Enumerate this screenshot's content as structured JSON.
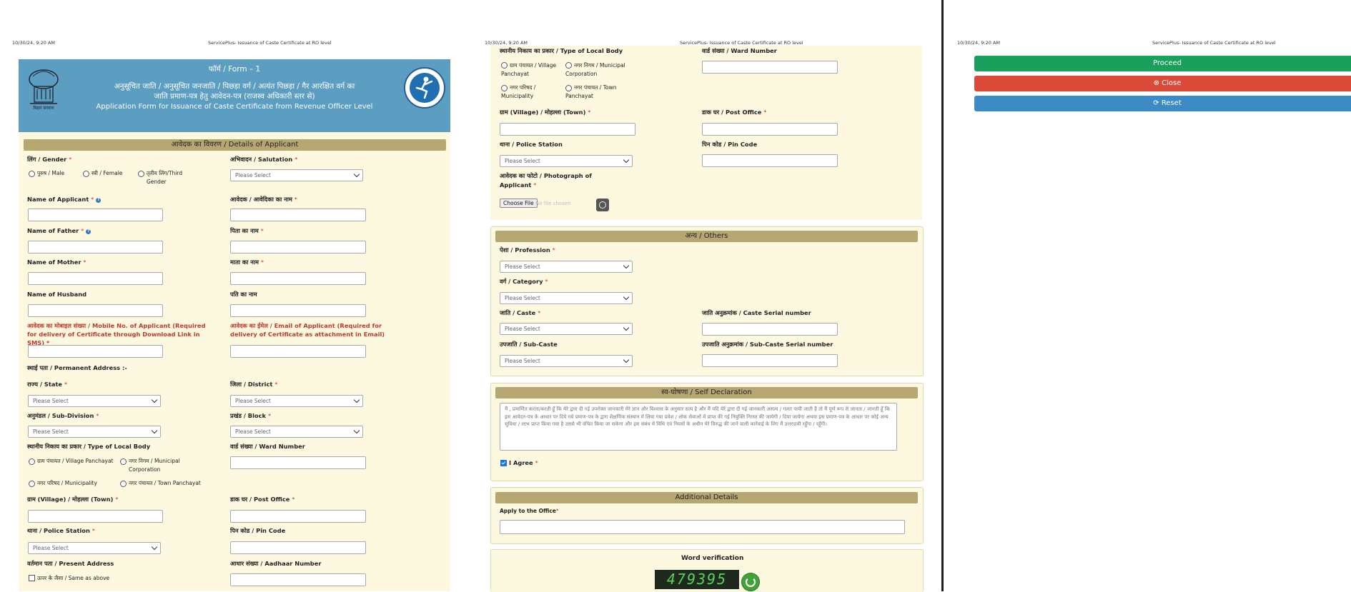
{
  "pages": [
    {
      "date": "10/30/24, 9:20 AM",
      "title": "ServicePlus- Issuance of Caste Certificate at RO level"
    },
    {
      "date": "10/30/24, 9:20 AM",
      "title": "ServicePlus- Issuance of Caste Certificate at RO level"
    },
    {
      "date": "10/30/24, 9:20 AM",
      "title": "ServicePlus- Issuance of Caste Certificate at RO level"
    }
  ],
  "banner": {
    "form_no": "फॉर्म / Form – 1",
    "hindi_line1": "अनुसूचित जाति / अनुसूचित जनजाति / पिछड़ा वर्ग / अत्यंत पिछड़ा / गैर आरक्षित वर्ग का",
    "hindi_line2": "जाति प्रमाण-पत्र हेतु आवेदन-पत्र (राजस्व अधिकारी स्तर से)",
    "english_title": "Application Form for Issuance of Caste Certificate from Revenue Officer Level",
    "emblem_caption": "बिहार सरकार"
  },
  "applicant": {
    "section_title": "आवेदक का विवरण / Details of Applicant",
    "gender_label": "लिंग / Gender",
    "gender_options": [
      "पुरुष / Male",
      "स्त्री / Female",
      "तृतीय लिंग/Third Gender"
    ],
    "salutation_label": "अभिवादन / Salutation",
    "name_label": "Name of Applicant",
    "name_hindi_label": "आवेदक / आवेदिका का नाम",
    "father_label": "Name of Father",
    "father_hindi_label": "पिता का नाम",
    "mother_label": "Name of Mother",
    "mother_hindi_label": "माता का नाम",
    "husband_label": "Name of Husband",
    "husband_hindi_label": "पति का नाम",
    "mobile_label": "आवेदक का मोबाइल संख्या / Mobile No. of Applicant (Required for delivery of Certificate through Download Link in SMS)",
    "email_label": "आवेदक का ईमेल / Email of Applicant (Required for delivery of Certificate as attachment in Email)",
    "permanent_address_label": "स्थाई पता / Permanent Address :-",
    "state_label": "राज्य / State",
    "district_label": "जिला / District",
    "subdivision_label": "अनुमंडल / Sub-Division",
    "block_label": "प्रखंड / Block",
    "local_body_label": "स्थानीय निकाय का प्रकार / Type of Local Body",
    "local_body_options": [
      "ग्राम पंचायत / Village Panchayat",
      "नगर निगम / Municipal Corporation",
      "नगर परिषद / Municipality",
      "नगर पंचायत / Town Panchayat"
    ],
    "ward_label": "वार्ड संख्या / Ward Number",
    "village_label": "ग्राम (Village) / मोहल्ला (Town)",
    "post_office_label": "डाक घर / Post Office",
    "police_label": "थाना / Police Station",
    "pin_label": "पिन कोड / Pin Code",
    "present_address_label": "वर्तमान पता / Present Address",
    "aadhaar_label": "आधार संख्या / Aadhaar Number",
    "same_as_above": "ऊपर के जैसा / Same as above"
  },
  "select_placeholder": "Please Select",
  "page2": {
    "local_body_label": "स्थानीय निकाय का प्रकार / Type of Local Body",
    "local_body_options": [
      "ग्राम पंचायत / Village Panchayat",
      "नगर निगम / Municipal Corporation",
      "नगर परिषद / Municipality",
      "नगर पंचायत / Town Panchayat"
    ],
    "ward_label": "वार्ड संख्या / Ward Number",
    "village_label": "ग्राम (Village) / मोहल्ला (Town)",
    "post_office_label": "डाक घर / Post Office",
    "police_label": "थाना / Police Station",
    "pin_label": "पिन कोड / Pin Code",
    "photo_label_1": "आवेदक का फोटो / Photograph of",
    "photo_label_2": "Applicant",
    "choose_file": "Choose File",
    "no_file": "No file chosen"
  },
  "others": {
    "section_title": "अन्य / Others",
    "profession_label": "पेशा / Profession",
    "category_label": "वर्ग / Category",
    "caste_label": "जाति / Caste",
    "caste_serial_label": "जाति अनुक्रमांक / Caste Serial number",
    "subcaste_label": "उपजाति / Sub-Caste",
    "subcaste_serial_label": "उपजाति अनुक्रमांक / Sub-Caste Serial number"
  },
  "declaration": {
    "section_title": "स्व-घोषणा / Self Declaration",
    "text": "मैं , प्रमाणित करता/करती हूँ कि मेरे द्वारा दी गई उपरोक्त जानकारी मेरे ज्ञान और विश्वास के अनुसार सत्य है और मैं  यदि मेरे द्वारा दी गई जानकारी असत्य / गलत पायी जाती है तो मैं पूर्ण रूप से  जानता / जानती हूँ कि इस आवेदन-पत्र के आधार पर दिये गये प्रमाण-पत्र के द्वारा शैक्षणिक संस्थान में लिया गया प्रवेश / लोक सेवाओं में प्राप्त की गई नियुक्ति निरस्त  की जायेगी / दिया जायेगा अथवा इस प्रमाण-पत्र के आधार पर कोई अन्य सुविधा / लाभ प्राप्त किया गया है उससे भी वंचित किया जा सकेगा और इस संबंध में विधि एवं नियमों के अधीन मेरे विरुद्ध की जाने वाली कार्रवाई के लिए मैं उत्तरदायी रहूँगा / रहूँगी।",
    "agree_label": "I Agree"
  },
  "additional": {
    "section_title": "Additional Details",
    "office_label": "Apply to the Office"
  },
  "verification": {
    "title": "Word verification",
    "captcha": "479395"
  },
  "buttons": {
    "proceed": "Proceed",
    "close": "Close",
    "reset": "Reset",
    "colors": {
      "proceed": "#1aa05d",
      "close": "#db4a38",
      "reset": "#3d8bc6"
    }
  },
  "colors": {
    "banner": "#5b9ec2",
    "section_bar": "#b6a772",
    "form_bg": "#fdf9e1",
    "required": "#c0392b"
  }
}
